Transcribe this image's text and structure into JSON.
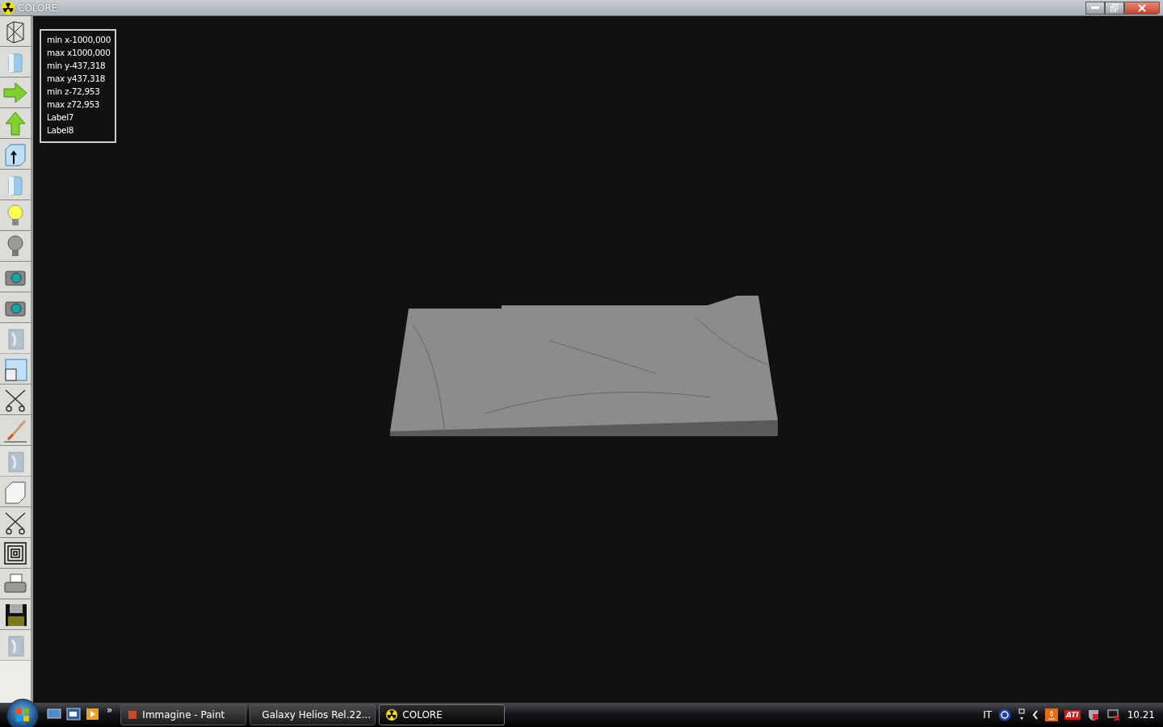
{
  "window": {
    "title": "COLORE"
  },
  "toolbar": [
    {
      "kind": "wireframe",
      "disabled": false
    },
    {
      "kind": "cylinder",
      "disabled": false
    },
    {
      "kind": "arrow-right",
      "disabled": false
    },
    {
      "kind": "arrow-up",
      "disabled": false
    },
    {
      "kind": "cube-arrow",
      "disabled": false
    },
    {
      "kind": "cylinder",
      "disabled": false
    },
    {
      "kind": "bulb-on",
      "disabled": false
    },
    {
      "kind": "bulb-off",
      "disabled": false
    },
    {
      "kind": "camera",
      "disabled": false
    },
    {
      "kind": "camera",
      "disabled": false
    },
    {
      "kind": "texture",
      "disabled": true
    },
    {
      "kind": "window",
      "disabled": false
    },
    {
      "kind": "scissors",
      "disabled": false
    },
    {
      "kind": "brush",
      "disabled": false
    },
    {
      "kind": "texture",
      "disabled": true
    },
    {
      "kind": "cube",
      "disabled": false
    },
    {
      "kind": "scissors",
      "disabled": false
    },
    {
      "kind": "squares",
      "disabled": false
    },
    {
      "kind": "printer",
      "disabled": false
    },
    {
      "kind": "floppy",
      "disabled": false
    },
    {
      "kind": "texture",
      "disabled": true
    }
  ],
  "info_panel": [
    "min x-1000,000",
    "max x1000,000",
    "min y-437,318",
    "max y437,318",
    "min z-72,953",
    "max z72,953",
    "Label7",
    "Label8"
  ],
  "taskbar": {
    "overflow": "»",
    "tasks": [
      {
        "label": "Immagine - Paint",
        "selected": false
      },
      {
        "label": "Galaxy Helios  Rel.22...",
        "selected": false
      },
      {
        "label": "COLORE",
        "selected": true
      }
    ],
    "language": "IT",
    "tray_badge": "ATI",
    "clock": "10.21"
  }
}
